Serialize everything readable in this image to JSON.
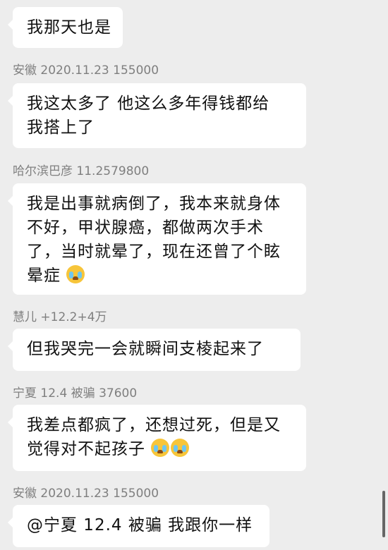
{
  "messages": [
    {
      "sender": "",
      "lines": [
        "我那天也是"
      ],
      "emoji_count": 0
    },
    {
      "sender": "安徽 2020.11.23 155000",
      "lines": [
        "我这太多了 他这么多年得钱都给",
        "我搭上了"
      ],
      "emoji_count": 0
    },
    {
      "sender": "哈尔滨巴彦 11.2579800",
      "lines": [
        "我是出事就病倒了，我本来就身体",
        "不好，甲状腺癌，都做两次手术",
        "了，当时就晕了，现在还曾了个眩",
        "晕症"
      ],
      "emoji": "loudly-crying-emoji",
      "emoji_count": 1
    },
    {
      "sender": "慧儿 +12.2+4万",
      "lines": [
        "但我哭完一会就瞬间支棱起来了"
      ],
      "emoji_count": 0
    },
    {
      "sender": "宁夏 12.4 被骗 37600",
      "lines": [
        "我差点都疯了，还想过死，但是又",
        "觉得对不起孩子"
      ],
      "emoji": "loudly-crying-emoji",
      "emoji_count": 2
    },
    {
      "sender": "安徽 2020.11.23 155000",
      "lines": [
        "@宁夏 12.4 被骗 我跟你一样"
      ],
      "emoji_count": 0
    }
  ]
}
